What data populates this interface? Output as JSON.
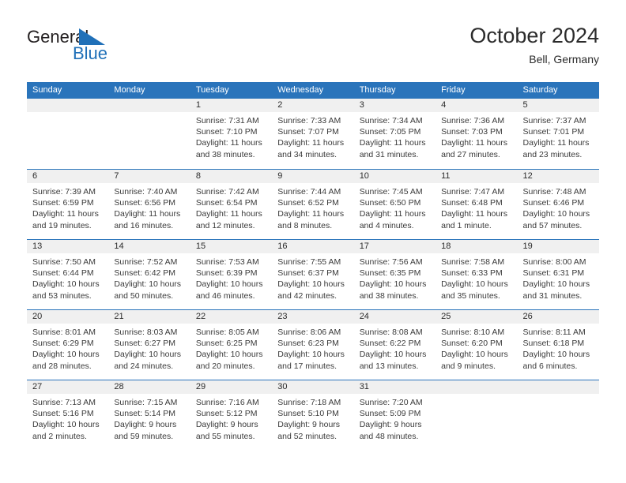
{
  "brand": {
    "name_top": "General",
    "name_bottom": "Blue",
    "flag_icon": "blue-triangle-flag-icon",
    "color_top": "#231f20",
    "color_bottom": "#2070b8"
  },
  "header": {
    "title": "October 2024",
    "subtitle": "Bell, Germany"
  },
  "theme": {
    "header_blue": "#2a74bb",
    "daynum_band": "#f0f0f0",
    "cell_bg": "#ffffff",
    "text": "#2b2b2b"
  },
  "calendar": {
    "weekday_headers": [
      "Sunday",
      "Monday",
      "Tuesday",
      "Wednesday",
      "Thursday",
      "Friday",
      "Saturday"
    ],
    "weeks": [
      [
        {
          "day": "",
          "lines": []
        },
        {
          "day": "",
          "lines": []
        },
        {
          "day": "1",
          "lines": [
            "Sunrise: 7:31 AM",
            "Sunset: 7:10 PM",
            "Daylight: 11 hours",
            "and 38 minutes."
          ]
        },
        {
          "day": "2",
          "lines": [
            "Sunrise: 7:33 AM",
            "Sunset: 7:07 PM",
            "Daylight: 11 hours",
            "and 34 minutes."
          ]
        },
        {
          "day": "3",
          "lines": [
            "Sunrise: 7:34 AM",
            "Sunset: 7:05 PM",
            "Daylight: 11 hours",
            "and 31 minutes."
          ]
        },
        {
          "day": "4",
          "lines": [
            "Sunrise: 7:36 AM",
            "Sunset: 7:03 PM",
            "Daylight: 11 hours",
            "and 27 minutes."
          ]
        },
        {
          "day": "5",
          "lines": [
            "Sunrise: 7:37 AM",
            "Sunset: 7:01 PM",
            "Daylight: 11 hours",
            "and 23 minutes."
          ]
        }
      ],
      [
        {
          "day": "6",
          "lines": [
            "Sunrise: 7:39 AM",
            "Sunset: 6:59 PM",
            "Daylight: 11 hours",
            "and 19 minutes."
          ]
        },
        {
          "day": "7",
          "lines": [
            "Sunrise: 7:40 AM",
            "Sunset: 6:56 PM",
            "Daylight: 11 hours",
            "and 16 minutes."
          ]
        },
        {
          "day": "8",
          "lines": [
            "Sunrise: 7:42 AM",
            "Sunset: 6:54 PM",
            "Daylight: 11 hours",
            "and 12 minutes."
          ]
        },
        {
          "day": "9",
          "lines": [
            "Sunrise: 7:44 AM",
            "Sunset: 6:52 PM",
            "Daylight: 11 hours",
            "and 8 minutes."
          ]
        },
        {
          "day": "10",
          "lines": [
            "Sunrise: 7:45 AM",
            "Sunset: 6:50 PM",
            "Daylight: 11 hours",
            "and 4 minutes."
          ]
        },
        {
          "day": "11",
          "lines": [
            "Sunrise: 7:47 AM",
            "Sunset: 6:48 PM",
            "Daylight: 11 hours",
            "and 1 minute."
          ]
        },
        {
          "day": "12",
          "lines": [
            "Sunrise: 7:48 AM",
            "Sunset: 6:46 PM",
            "Daylight: 10 hours",
            "and 57 minutes."
          ]
        }
      ],
      [
        {
          "day": "13",
          "lines": [
            "Sunrise: 7:50 AM",
            "Sunset: 6:44 PM",
            "Daylight: 10 hours",
            "and 53 minutes."
          ]
        },
        {
          "day": "14",
          "lines": [
            "Sunrise: 7:52 AM",
            "Sunset: 6:42 PM",
            "Daylight: 10 hours",
            "and 50 minutes."
          ]
        },
        {
          "day": "15",
          "lines": [
            "Sunrise: 7:53 AM",
            "Sunset: 6:39 PM",
            "Daylight: 10 hours",
            "and 46 minutes."
          ]
        },
        {
          "day": "16",
          "lines": [
            "Sunrise: 7:55 AM",
            "Sunset: 6:37 PM",
            "Daylight: 10 hours",
            "and 42 minutes."
          ]
        },
        {
          "day": "17",
          "lines": [
            "Sunrise: 7:56 AM",
            "Sunset: 6:35 PM",
            "Daylight: 10 hours",
            "and 38 minutes."
          ]
        },
        {
          "day": "18",
          "lines": [
            "Sunrise: 7:58 AM",
            "Sunset: 6:33 PM",
            "Daylight: 10 hours",
            "and 35 minutes."
          ]
        },
        {
          "day": "19",
          "lines": [
            "Sunrise: 8:00 AM",
            "Sunset: 6:31 PM",
            "Daylight: 10 hours",
            "and 31 minutes."
          ]
        }
      ],
      [
        {
          "day": "20",
          "lines": [
            "Sunrise: 8:01 AM",
            "Sunset: 6:29 PM",
            "Daylight: 10 hours",
            "and 28 minutes."
          ]
        },
        {
          "day": "21",
          "lines": [
            "Sunrise: 8:03 AM",
            "Sunset: 6:27 PM",
            "Daylight: 10 hours",
            "and 24 minutes."
          ]
        },
        {
          "day": "22",
          "lines": [
            "Sunrise: 8:05 AM",
            "Sunset: 6:25 PM",
            "Daylight: 10 hours",
            "and 20 minutes."
          ]
        },
        {
          "day": "23",
          "lines": [
            "Sunrise: 8:06 AM",
            "Sunset: 6:23 PM",
            "Daylight: 10 hours",
            "and 17 minutes."
          ]
        },
        {
          "day": "24",
          "lines": [
            "Sunrise: 8:08 AM",
            "Sunset: 6:22 PM",
            "Daylight: 10 hours",
            "and 13 minutes."
          ]
        },
        {
          "day": "25",
          "lines": [
            "Sunrise: 8:10 AM",
            "Sunset: 6:20 PM",
            "Daylight: 10 hours",
            "and 9 minutes."
          ]
        },
        {
          "day": "26",
          "lines": [
            "Sunrise: 8:11 AM",
            "Sunset: 6:18 PM",
            "Daylight: 10 hours",
            "and 6 minutes."
          ]
        }
      ],
      [
        {
          "day": "27",
          "lines": [
            "Sunrise: 7:13 AM",
            "Sunset: 5:16 PM",
            "Daylight: 10 hours",
            "and 2 minutes."
          ]
        },
        {
          "day": "28",
          "lines": [
            "Sunrise: 7:15 AM",
            "Sunset: 5:14 PM",
            "Daylight: 9 hours",
            "and 59 minutes."
          ]
        },
        {
          "day": "29",
          "lines": [
            "Sunrise: 7:16 AM",
            "Sunset: 5:12 PM",
            "Daylight: 9 hours",
            "and 55 minutes."
          ]
        },
        {
          "day": "30",
          "lines": [
            "Sunrise: 7:18 AM",
            "Sunset: 5:10 PM",
            "Daylight: 9 hours",
            "and 52 minutes."
          ]
        },
        {
          "day": "31",
          "lines": [
            "Sunrise: 7:20 AM",
            "Sunset: 5:09 PM",
            "Daylight: 9 hours",
            "and 48 minutes."
          ]
        },
        {
          "day": "",
          "lines": []
        },
        {
          "day": "",
          "lines": []
        }
      ]
    ]
  }
}
